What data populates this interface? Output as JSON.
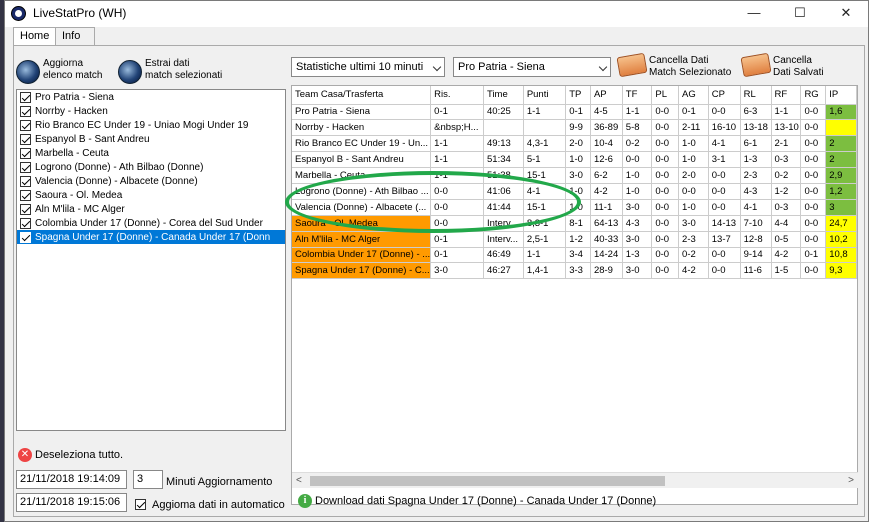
{
  "window": {
    "title": "LiveStatPro (WH)",
    "minimize": "—",
    "maximize": "☐",
    "close": "✕"
  },
  "tabs": [
    {
      "label": "Home"
    },
    {
      "label": "Info"
    }
  ],
  "toolbar": {
    "refresh_line1": "Aggiorna",
    "refresh_line2": "elenco match",
    "extract_line1": "Estrai dati",
    "extract_line2": "match selezionati",
    "stats_select": "Statistiche ultimi 10 minuti",
    "match_select": "Pro Patria - Siena",
    "clear_selected_line1": "Cancella Dati",
    "clear_selected_line2": "Match Selezionato",
    "clear_saved_line1": "Cancella",
    "clear_saved_line2": "Dati Salvati"
  },
  "match_list": [
    "Pro Patria  - Siena",
    "Norrby  - Hacken",
    "Rio Branco EC Under 19  - Uniao Mogi Under 19",
    "Espanyol B  - Sant Andreu",
    "Marbella  - Ceuta",
    "Logrono (Donne)  - Ath Bilbao (Donne)",
    "Valencia (Donne)  - Albacete (Donne)",
    "Saoura  - Ol. Medea",
    "Aln M'lila  - MC Alger",
    "Colombia Under 17 (Donne)  - Corea del Sud Under",
    "Spagna Under 17 (Donne)  - Canada Under 17 (Donn"
  ],
  "table": {
    "headers": [
      "Team Casa/Trasferta",
      "Ris.",
      "Time",
      "Punti",
      "TP",
      "AP",
      "TF",
      "PL",
      "AG",
      "CP",
      "RL",
      "RF",
      "RG",
      "IP"
    ],
    "rows": [
      [
        "Pro Patria - Siena",
        "0-1",
        "40:25",
        "1-1",
        "0-1",
        "4-5",
        "1-1",
        "0-0",
        "0-1",
        "0-0",
        "6-3",
        "1-1",
        "0-0",
        "1,6"
      ],
      [
        "Norrby - Hacken",
        "&nbsp;H...",
        "",
        "",
        "9-9",
        "36-89",
        "5-8",
        "0-0",
        "2-11",
        "16-10",
        "13-18",
        "13-10",
        "0-0",
        ""
      ],
      [
        "Rio Branco EC Under 19 - Un...",
        "1-1",
        "49:13",
        "4,3-1",
        "2-0",
        "10-4",
        "0-2",
        "0-0",
        "1-0",
        "4-1",
        "6-1",
        "2-1",
        "0-0",
        "2"
      ],
      [
        "Espanyol B - Sant Andreu",
        "1-1",
        "51:34",
        "5-1",
        "1-0",
        "12-6",
        "0-0",
        "0-0",
        "1-0",
        "3-1",
        "1-3",
        "0-3",
        "0-0",
        "2"
      ],
      [
        "Marbella - Ceuta",
        "1-1",
        "51:38",
        "15-1",
        "3-0",
        "6-2",
        "1-0",
        "0-0",
        "2-0",
        "0-0",
        "2-3",
        "0-2",
        "0-0",
        "2,9"
      ],
      [
        "Logrono (Donne) - Ath Bilbao ...",
        "0-0",
        "41:06",
        "4-1",
        "1-0",
        "4-2",
        "1-0",
        "0-0",
        "0-0",
        "0-0",
        "4-3",
        "1-2",
        "0-0",
        "1,2"
      ],
      [
        "Valencia (Donne) - Albacete (...",
        "0-0",
        "41:44",
        "15-1",
        "1-0",
        "11-1",
        "3-0",
        "0-0",
        "1-0",
        "0-0",
        "4-1",
        "0-3",
        "0-0",
        "3"
      ],
      [
        "Saoura - Ol. Medea",
        "0-0",
        "Interv...",
        "8,3-1",
        "8-1",
        "64-13",
        "4-3",
        "0-0",
        "3-0",
        "14-13",
        "7-10",
        "4-4",
        "0-0",
        "24,7"
      ],
      [
        "Aln M'lila - MC Alger",
        "0-1",
        "Interv...",
        "2,5-1",
        "1-2",
        "40-33",
        "3-0",
        "0-0",
        "2-3",
        "13-7",
        "12-8",
        "0-5",
        "0-0",
        "10,2"
      ],
      [
        "Colombia Under 17 (Donne) - ...",
        "0-1",
        "46:49",
        "1-1",
        "3-4",
        "14-24",
        "1-3",
        "0-0",
        "0-2",
        "0-0",
        "9-14",
        "4-2",
        "0-1",
        "10,8"
      ],
      [
        "Spagna Under 17 (Donne) - C...",
        "3-0",
        "46:27",
        "1,4-1",
        "3-3",
        "28-9",
        "3-0",
        "0-0",
        "4-2",
        "0-0",
        "11-6",
        "1-5",
        "0-0",
        "9,3"
      ]
    ]
  },
  "bottom": {
    "deselect_all": "Deseleziona tutto.",
    "datetime1": "21/11/2018 19:14:09",
    "minutes": "3",
    "minutes_label": "Minuti Aggiornamento",
    "datetime2": "21/11/2018 19:15:06",
    "auto_update_label": "Aggioma dati  in automatico",
    "status": "Download dati Spagna Under 17 (Donne) - Canada Under 17 (Donne)"
  },
  "colors": {
    "orange": "#ff9a00",
    "green": "#7cbe40",
    "yellow": "#ffff00",
    "selection": "#0078d7",
    "annotation": "#22a84a"
  }
}
